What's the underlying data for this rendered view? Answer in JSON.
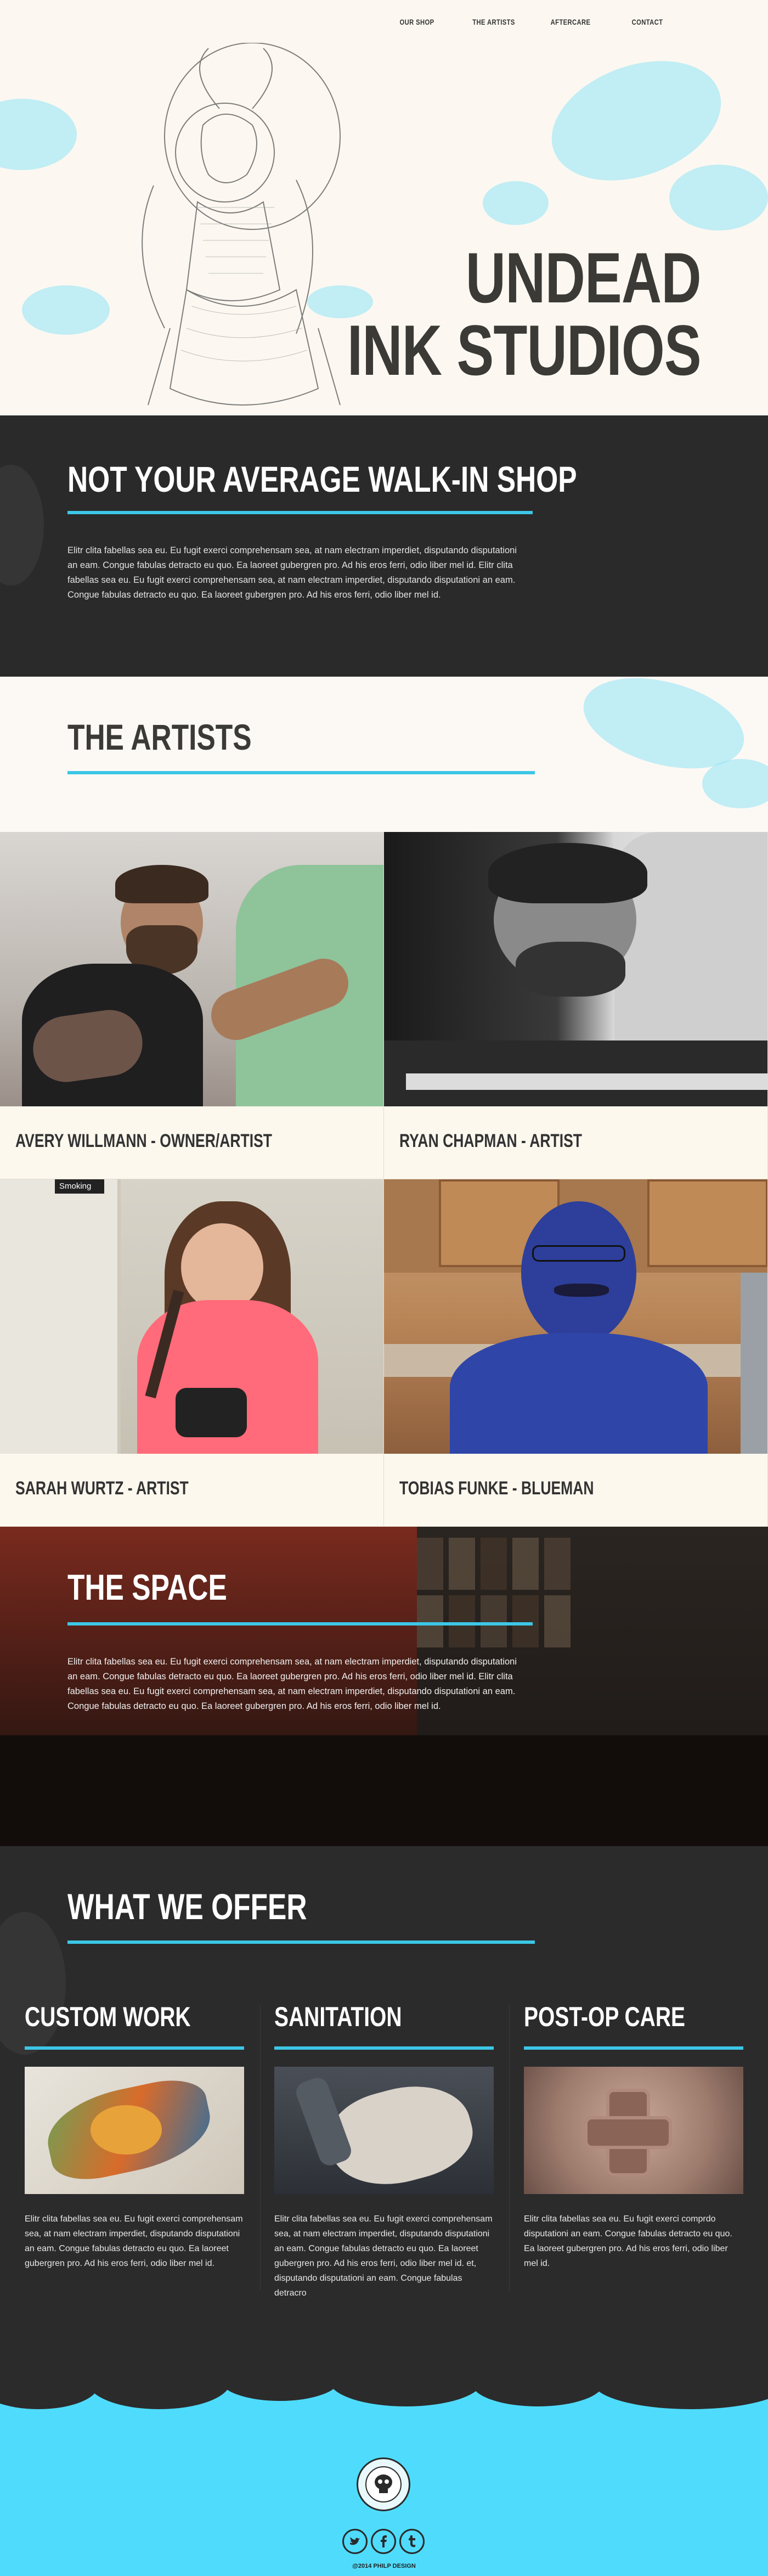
{
  "nav": {
    "items": [
      "OUR SHOP",
      "THE ARTISTS",
      "AFTERCARE",
      "CONTACT"
    ]
  },
  "hero": {
    "line1": "UNDEAD",
    "line2": "INK STUDIOS"
  },
  "intro": {
    "title": "NOT YOUR AVERAGE WALK-IN SHOP",
    "text": "Elitr clita fabellas sea eu. Eu fugit exerci comprehensam sea, at nam electram imperdiet, disputando disputationi an eam. Congue fabulas detracto eu quo. Ea laoreet gubergren pro. Ad his eros ferri, odio liber mel id. Elitr clita fabellas sea eu. Eu fugit exerci comprehensam sea, at nam electram imperdiet, disputando disputationi an eam. Congue fabulas detracto eu quo. Ea laoreet gubergren pro. Ad his eros ferri, odio liber mel id."
  },
  "artists": {
    "title": "THE ARTISTS",
    "cards": [
      {
        "caption": "AVERY WILLMANN - OWNER/ARTIST"
      },
      {
        "caption": "RYAN CHAPMAN - ARTIST"
      },
      {
        "caption": "SARAH WURTZ - ARTIST"
      },
      {
        "caption": "TOBIAS FUNKE -  BLUEMAN"
      }
    ],
    "sign": "Smoking"
  },
  "space": {
    "title": "THE SPACE",
    "text": "Elitr clita fabellas sea eu. Eu fugit exerci comprehensam sea, at nam electram imperdiet, disputando disputationi an eam. Congue fabulas detracto eu quo. Ea laoreet gubergren pro. Ad his eros ferri, odio liber mel id. Elitr clita fabellas sea eu. Eu fugit exerci comprehensam sea, at nam electram imperdiet, disputando disputationi an eam. Congue fabulas detracto eu quo. Ea laoreet gubergren pro. Ad his eros ferri, odio liber mel id."
  },
  "offer": {
    "title": "WHAT WE OFFER",
    "columns": [
      {
        "title": "CUSTOM WORK",
        "text": "Elitr clita fabellas sea eu. Eu fugit exerci comprehensam sea, at nam electram imperdiet, disputando disputationi an eam. Congue fabulas detracto eu quo. Ea laoreet gubergren pro. Ad his eros ferri, odio liber mel id."
      },
      {
        "title": "SANITATION",
        "text": "Elitr clita fabellas sea eu. Eu fugit exerci comprehensam sea, at nam electram imperdiet, disputando disputationi an eam. Congue fabulas detracto eu quo. Ea laoreet gubergren pro. Ad his eros ferri, odio liber mel id. et, disputando disputationi an eam. Congue fabulas detracro"
      },
      {
        "title": "POST-OP CARE",
        "text": "Elitr clita fabellas sea eu. Eu fugit exerci comprdo disputationi an eam. Congue fabulas detracto eu quo. Ea laoreet gubergren pro. Ad his eros ferri, odio liber mel id."
      }
    ]
  },
  "footer": {
    "social": [
      "twitter-icon",
      "facebook-icon",
      "tumblr-icon"
    ],
    "copyright": "@2014 PHILP DESIGN"
  },
  "colors": {
    "accent": "#3cc7e6",
    "dark": "#2a2a2b",
    "cream": "#fcf9f4",
    "footer": "#4fdcfc"
  }
}
